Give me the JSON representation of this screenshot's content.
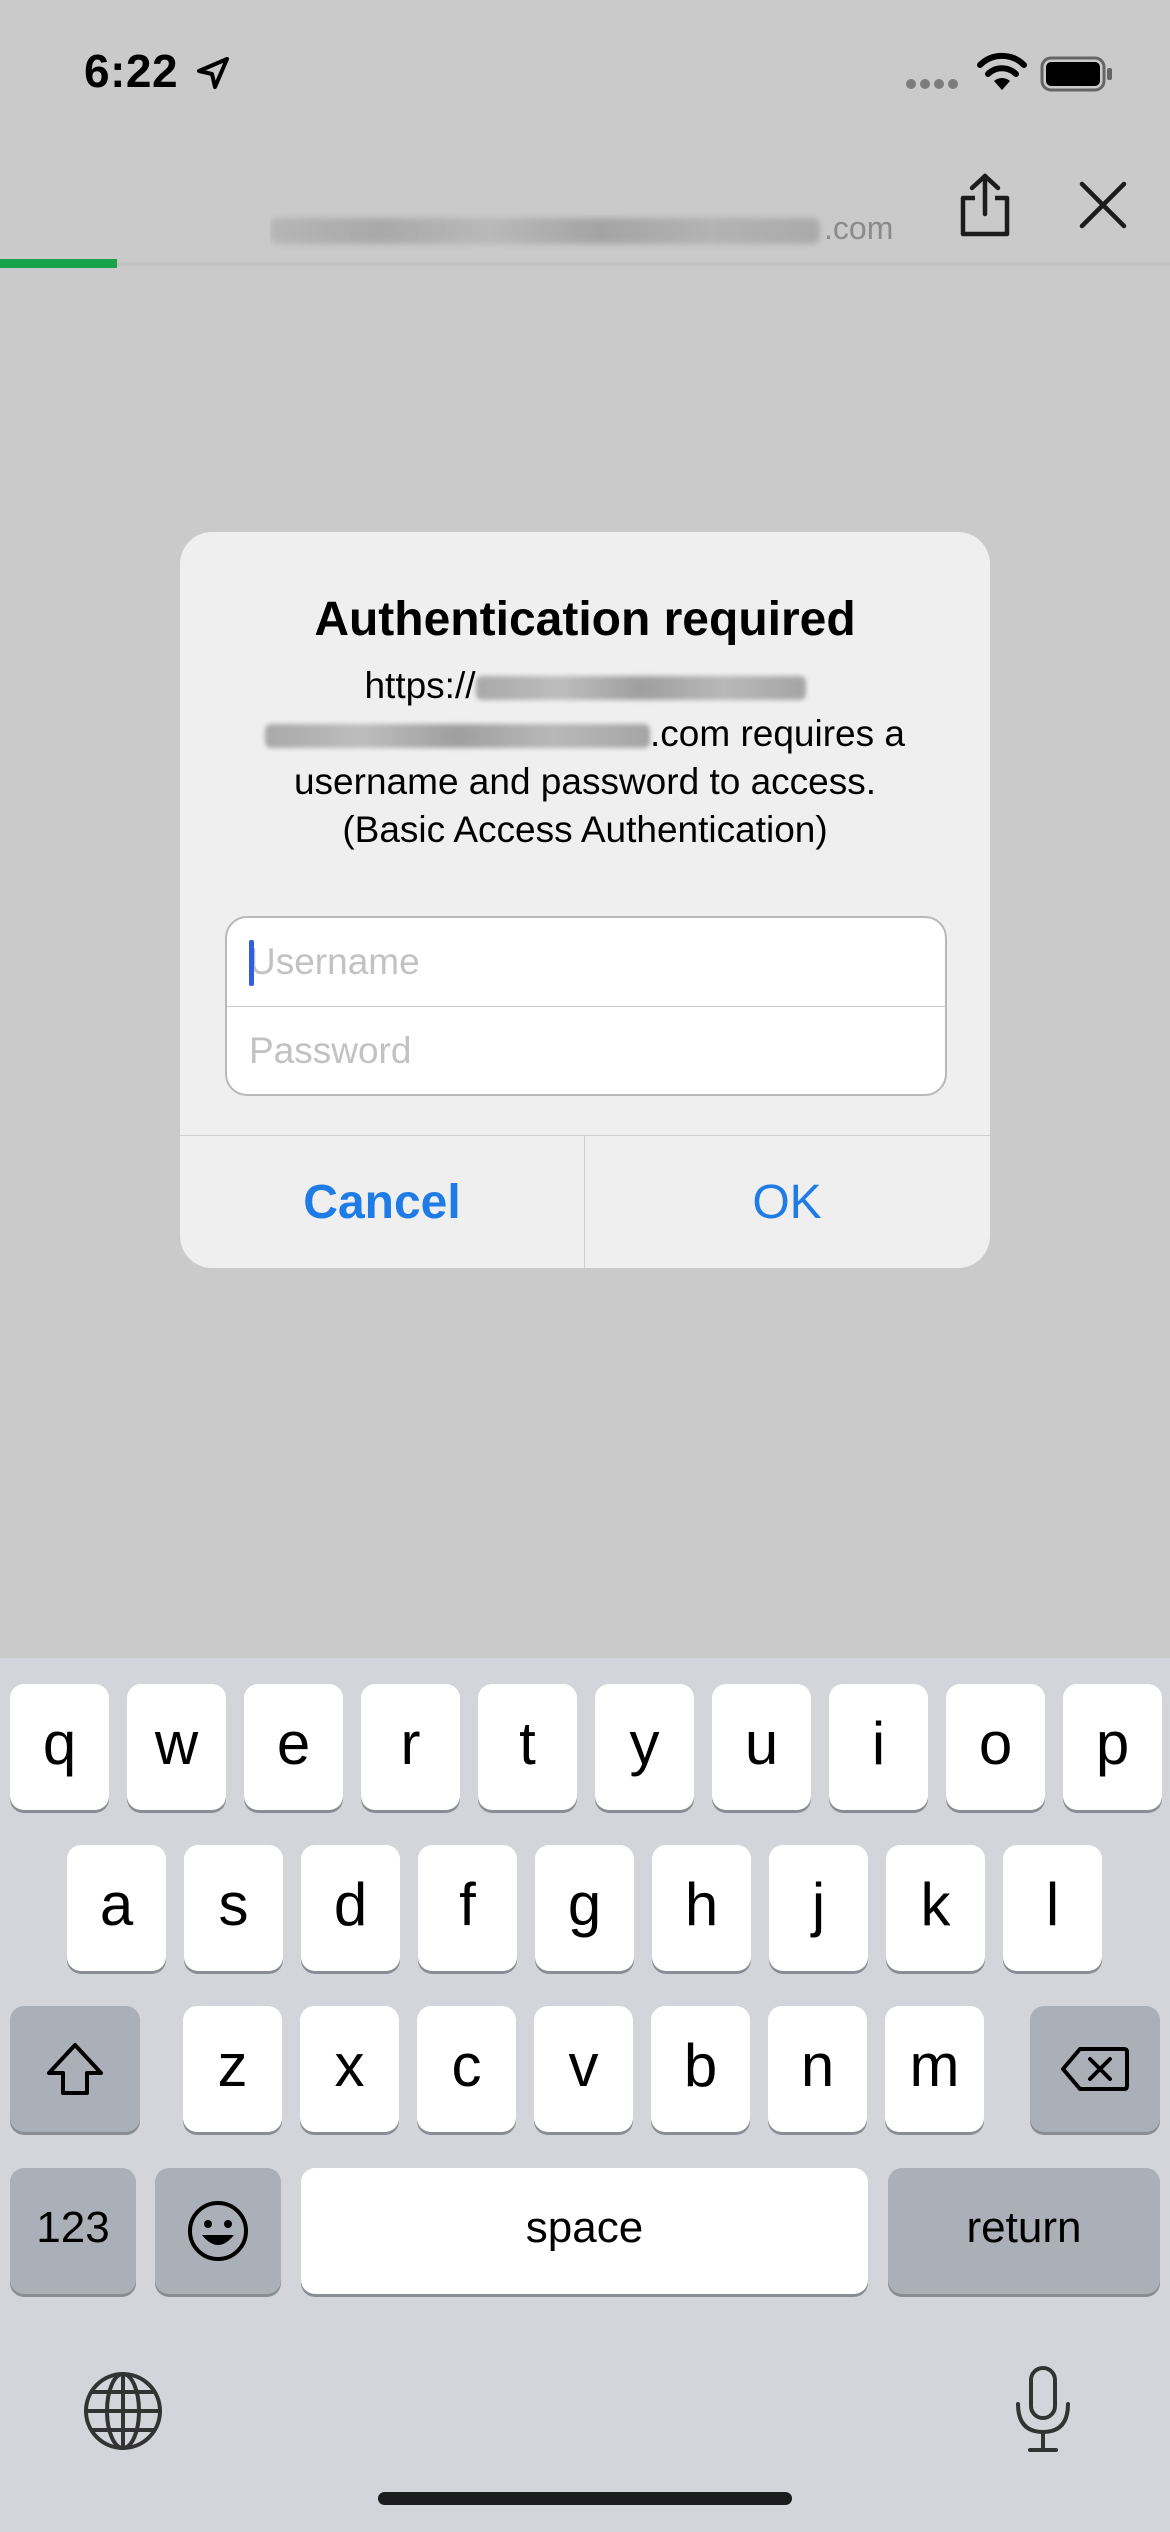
{
  "status_bar": {
    "time": "6:22"
  },
  "toolbar": {
    "url_suffix": ".com",
    "progress": 0.1
  },
  "dialog": {
    "title": "Authentication required",
    "message_prefix": "https://",
    "message_mid": ".com requires a",
    "message_line3": "username and password to access.",
    "message_line4": "(Basic Access Authentication)",
    "username_placeholder": "Username",
    "username_value": "",
    "password_placeholder": "Password",
    "password_value": "",
    "cancel_label": "Cancel",
    "ok_label": "OK"
  },
  "keyboard": {
    "row1": [
      "q",
      "w",
      "e",
      "r",
      "t",
      "y",
      "u",
      "i",
      "o",
      "p"
    ],
    "row2": [
      "a",
      "s",
      "d",
      "f",
      "g",
      "h",
      "j",
      "k",
      "l"
    ],
    "row3": [
      "z",
      "x",
      "c",
      "v",
      "b",
      "n",
      "m"
    ],
    "numbers_label": "123",
    "space_label": "space",
    "return_label": "return"
  }
}
